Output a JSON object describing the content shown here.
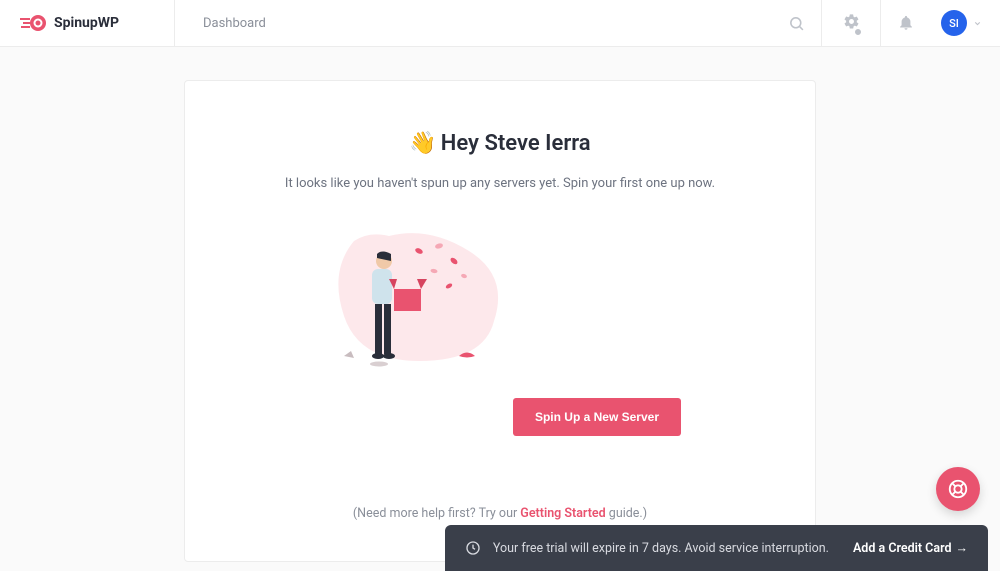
{
  "brand": {
    "name": "SpinupWP"
  },
  "nav": {
    "title": "Dashboard"
  },
  "user": {
    "initials": "SI"
  },
  "onboarding": {
    "wave_emoji": "👋",
    "greeting": "Hey Steve Ierra",
    "subtext": "It looks like you haven't spun up any servers yet. Spin your first one up now.",
    "cta_label": "Spin Up a New Server",
    "help_prefix": "(Need more help first? Try our ",
    "help_link_text": "Getting Started",
    "help_suffix": " guide.)"
  },
  "toast": {
    "message": "Your free trial will expire in 7 days. Avoid service interruption.",
    "action_label": "Add a Credit Card",
    "arrow": "→"
  }
}
